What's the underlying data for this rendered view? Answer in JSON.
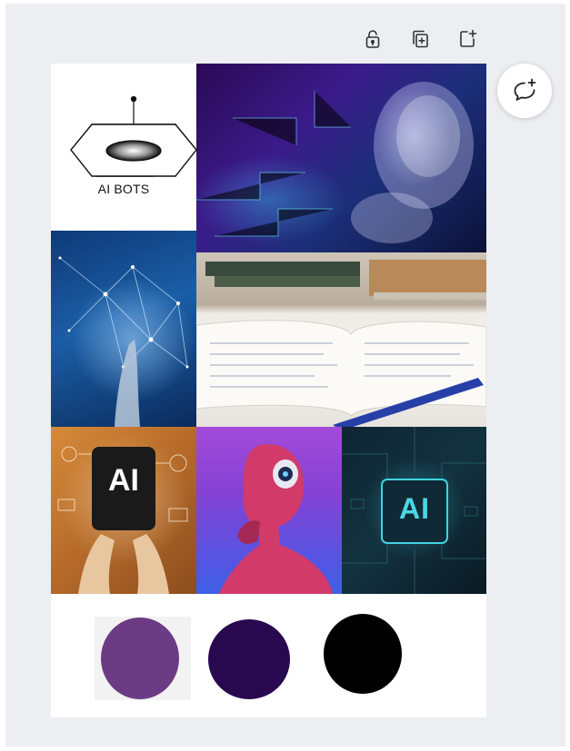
{
  "logo": {
    "text": "AI BOTS"
  },
  "tiles": {
    "ai_tablet_text": "AI",
    "ai_chip_text": "AI"
  },
  "palette": {
    "colors": [
      "#6b3b84",
      "#28094f",
      "#000000"
    ]
  },
  "icons": {
    "lock": "lock-icon",
    "duplicate": "duplicate-page-icon",
    "add_page": "add-page-icon",
    "comment": "add-comment-icon"
  }
}
